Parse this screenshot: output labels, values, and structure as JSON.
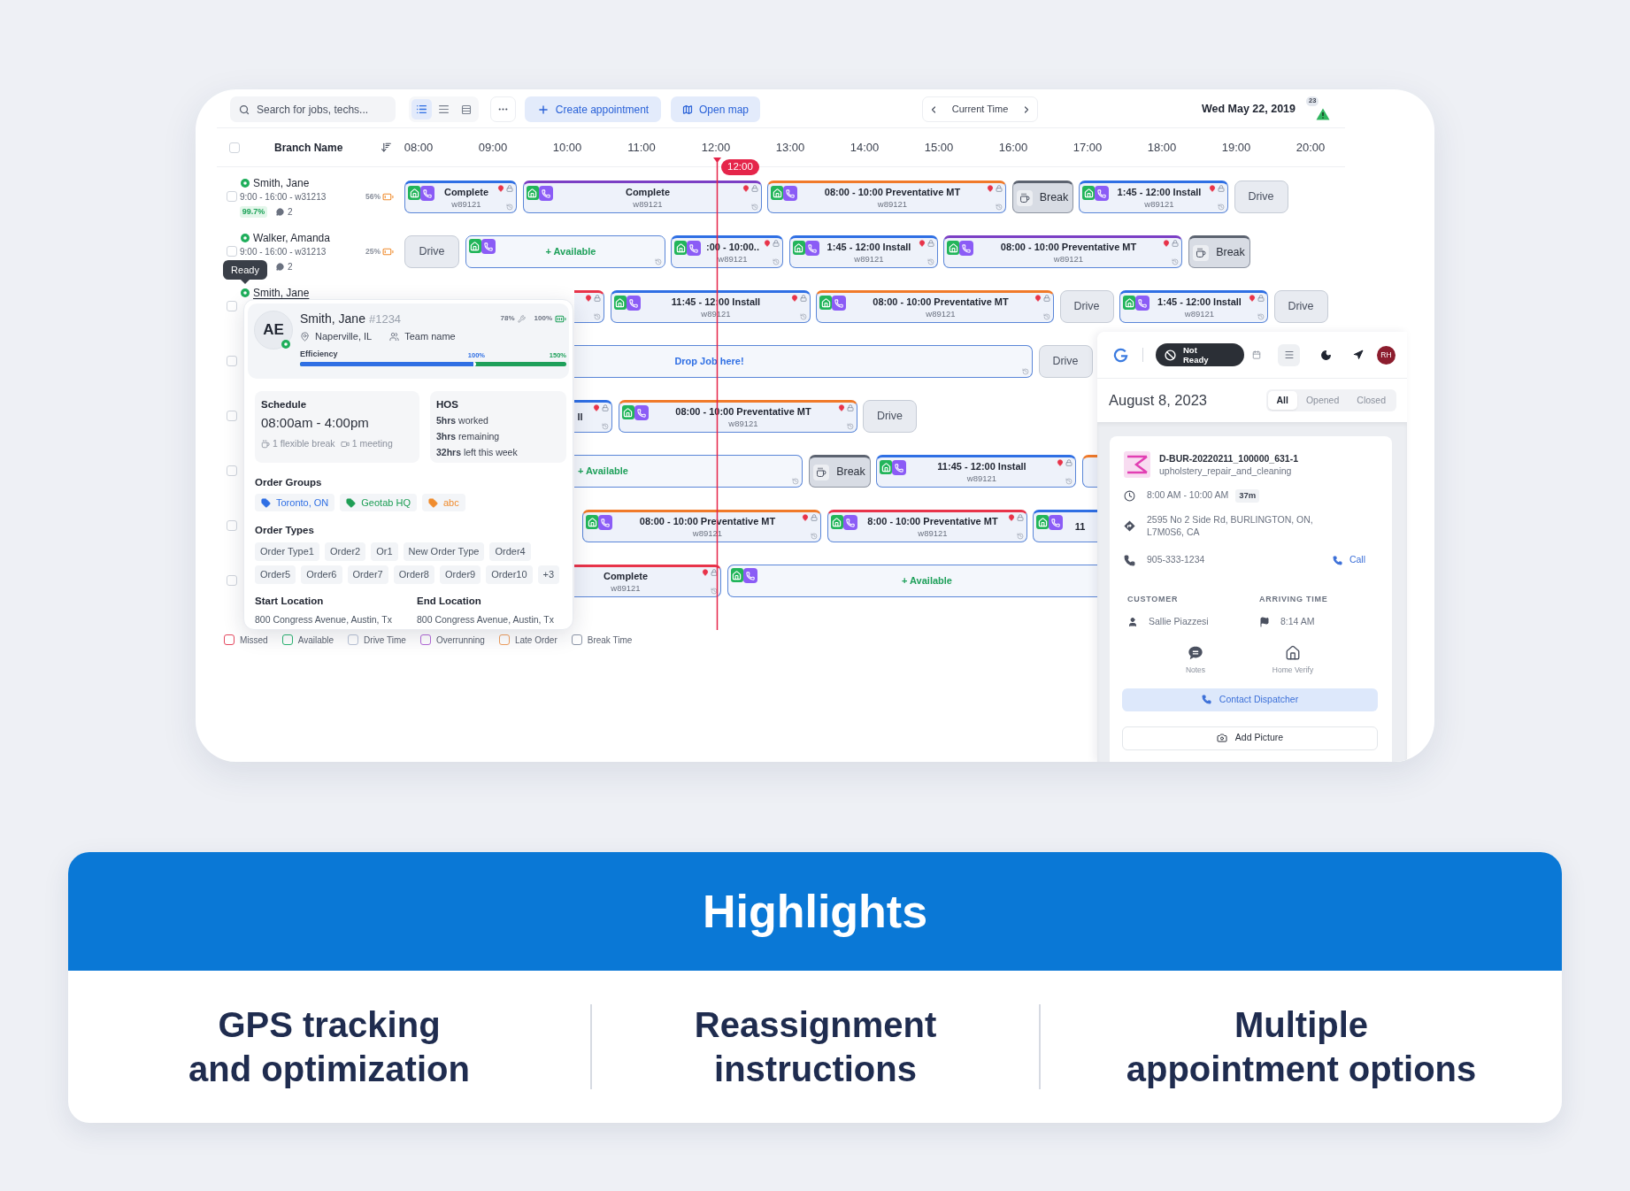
{
  "toolbar": {
    "search": {
      "placeholder": "Search for jobs, techs..."
    },
    "view_modes": [
      {
        "kind": "list",
        "selected": true
      },
      {
        "kind": "lines",
        "selected": false
      },
      {
        "kind": "compact",
        "selected": false
      }
    ],
    "create_button": "Create appointment",
    "map_button": "Open map",
    "time_nav": "Current Time",
    "date": "Wed May 22, 2019",
    "alert_count": "23"
  },
  "schedule": {
    "select_all": {
      "checked": false
    },
    "branch_label": "Branch Name",
    "hours": [
      "08:00",
      "09:00",
      "10:00",
      "11:00",
      "12:00",
      "13:00",
      "14:00",
      "15:00",
      "16:00",
      "17:00",
      "18:00",
      "19:00",
      "20:00"
    ],
    "now_marker": "12:00",
    "rows": [
      {
        "checked": false,
        "technician": {
          "name": "Smith, Jane",
          "hovered": false,
          "shift": "9:00 - 16:00 - w31213",
          "battery": "56%",
          "efficiency": "99.7%",
          "messages": "2"
        },
        "events": [
          {
            "kind": "job",
            "title": "Complete",
            "code": "w89121",
            "color": "#2f6fe4",
            "app_icons": true,
            "markers": true
          },
          {
            "kind": "job",
            "title": "Complete",
            "code": "w89121",
            "color": "#7b3fc4",
            "app_icons": true,
            "markers": true
          },
          {
            "kind": "job",
            "title": "08:00 - 10:00 Preventative MT",
            "code": "w89121",
            "color": "#f07a2a",
            "app_icons": true,
            "markers": true
          },
          {
            "kind": "break",
            "title": "Break"
          },
          {
            "kind": "job",
            "title": "1:45 - 12:00 Install",
            "code": "w89121",
            "color": "#2f6fe4",
            "app_icons": true,
            "markers": true
          },
          {
            "kind": "drive",
            "title": "Drive"
          }
        ]
      },
      {
        "checked": false,
        "technician": {
          "name": "Walker, Amanda",
          "hovered": false,
          "shift": "9:00 - 16:00 - w31213",
          "battery": "25%",
          "messages": "2"
        },
        "events": [
          {
            "kind": "drive",
            "title": "Drive"
          },
          {
            "kind": "available",
            "title": "+ Available",
            "app_icons": true,
            "markers": true
          },
          {
            "kind": "job",
            "title": ":00 - 10:00..",
            "code": "w89121",
            "color": "#2f6fe4",
            "app_icons": true,
            "markers": true
          },
          {
            "kind": "job",
            "title": "1:45 - 12:00 Install",
            "code": "w89121",
            "color": "#2f6fe4",
            "app_icons": true,
            "markers": true
          },
          {
            "kind": "job",
            "title": "08:00 - 10:00 Preventative MT",
            "code": "w89121",
            "color": "#7b3fc4",
            "app_icons": true,
            "markers": true
          },
          {
            "kind": "break",
            "title": "Break"
          }
        ]
      },
      {
        "checked": false,
        "technician": {
          "name": "Smith, Jane",
          "hovered": true,
          "tooltip": "Ready"
        },
        "events": [
          {
            "kind": "job",
            "color": "#e8344a",
            "app_icons": false,
            "markers": true
          },
          {
            "kind": "job",
            "title": "11:45 - 12:00 Install",
            "code": "w89121",
            "color": "#2f6fe4",
            "app_icons": true,
            "markers": true
          },
          {
            "kind": "job",
            "title": "08:00 - 10:00 Preventative MT",
            "code": "w89121",
            "color": "#f07a2a",
            "app_icons": true,
            "markers": true
          },
          {
            "kind": "drive",
            "title": "Drive"
          },
          {
            "kind": "job",
            "title": "1:45 - 12:00 Install",
            "code": "w89121",
            "color": "#2f6fe4",
            "app_icons": true,
            "markers": true
          },
          {
            "kind": "drive",
            "title": "Drive"
          }
        ]
      },
      {
        "checked": false,
        "events": [
          {
            "kind": "drop",
            "title": "Drop Job here!",
            "markers": true
          },
          {
            "kind": "drive",
            "title": "Drive"
          }
        ]
      },
      {
        "checked": false,
        "events": [
          {
            "kind": "job",
            "title": "ll",
            "color": "#2f6fe4",
            "app_icons": false,
            "markers": true
          },
          {
            "kind": "job",
            "title": "08:00 - 10:00 Preventative MT",
            "code": "w89121",
            "color": "#f07a2a",
            "app_icons": true,
            "markers": true
          },
          {
            "kind": "drive",
            "title": "Drive"
          }
        ]
      },
      {
        "checked": false,
        "events": [
          {
            "kind": "available",
            "title": "+ Available",
            "app_icons": false,
            "markers": true
          },
          {
            "kind": "break",
            "title": "Break"
          },
          {
            "kind": "job",
            "title": "11:45 - 12:00 Install",
            "code": "w89121",
            "color": "#2f6fe4",
            "app_icons": true,
            "markers": true
          },
          {
            "kind": "job",
            "color": "#f07a2a",
            "app_icons": false,
            "markers": false
          }
        ]
      },
      {
        "checked": false,
        "events": [
          {
            "kind": "job",
            "title": "08:00 - 10:00 Preventative MT",
            "code": "w89121",
            "color": "#f07a2a",
            "app_icons": true,
            "markers": true
          },
          {
            "kind": "job",
            "title": "8:00 - 10:00 Preventative MT",
            "code": "w89121",
            "color": "#e8344a",
            "app_icons": true,
            "markers": true
          },
          {
            "kind": "job",
            "title": "11",
            "color": "#2f6fe4",
            "app_icons": true,
            "markers": false
          }
        ]
      },
      {
        "checked": false,
        "events": [
          {
            "kind": "job",
            "title": "Complete",
            "code": "w89121",
            "color": "#e8344a",
            "app_icons": false,
            "markers": true
          },
          {
            "kind": "available",
            "title": "+ Available",
            "app_icons": true,
            "markers": false
          }
        ]
      }
    ],
    "legend": [
      {
        "label": "Missed",
        "color": "#e5485f"
      },
      {
        "label": "Available",
        "color": "#2bb673"
      },
      {
        "label": "Drive Time",
        "color": "#b9c3d6"
      },
      {
        "label": "Overrunning",
        "color": "#b36ad8"
      },
      {
        "label": "Late Order",
        "color": "#f0a060"
      },
      {
        "label": "Break Time",
        "color": "#8d97a8"
      }
    ]
  },
  "technician_card": {
    "initials": "AE",
    "name": "Smith, Jane",
    "number": "#1234",
    "signal": "78%",
    "battery": "100%",
    "location": "Naperville, IL",
    "team": "Team name",
    "efficiency_label": "Efficiency",
    "efficiency_marks": [
      "100%",
      "150%"
    ],
    "efficiency": {
      "level": 0.66
    },
    "schedule_label": "Schedule",
    "hours": "08:00am - 4:00pm",
    "breaks": "1 flexible break",
    "meetings": "1 meeting",
    "hos_label": "HOS",
    "hos": [
      "**5hrs** worked",
      "**3hrs** remaining",
      "**32hrs** left this week"
    ],
    "groups_label": "Order Groups",
    "groups": [
      {
        "label": "Toronto, ON",
        "color": "#2f6fe4"
      },
      {
        "label": "Geotab HQ",
        "color": "#1e9e55"
      },
      {
        "label": "abc",
        "color": "#f08c2e"
      }
    ],
    "types_label": "Order Types",
    "types": [
      "Order Type1",
      "Order2",
      "Or1",
      "New Order Type",
      "Order4",
      "Order5",
      "Order6",
      "Order7",
      "Order8",
      "Order9",
      "Order10",
      "+3"
    ],
    "start_label": "Start Location",
    "start": "800 Congress Avenue, Austin, Tx",
    "end_label": "End Location",
    "end": "800 Congress Avenue, Austin, Tx"
  },
  "mobile_panel": {
    "status": "Not Ready",
    "avatar": "RH",
    "date": "August 8, 2023",
    "filters": [
      {
        "label": "All",
        "selected": true
      },
      {
        "label": "Opened",
        "selected": false
      },
      {
        "label": "Closed",
        "selected": false
      }
    ],
    "job": {
      "id": "D-BUR-20220211_100000_631-1",
      "type": "upholstery_repair_and_cleaning",
      "time": "8:00 AM - 10:00 AM",
      "duration": "37m",
      "address": "2595 No 2 Side Rd, BURLINGTON, ON, L7M0S6, CA",
      "phone": "905-333-1234",
      "call_button": "Call",
      "customer_label": "CUSTOMER",
      "customer": "Sallie Piazzesi",
      "arriving_label": "ARRIVING TIME",
      "arriving": "8:14 AM",
      "actions": [
        {
          "kind": "notes",
          "label": "Notes"
        },
        {
          "kind": "home",
          "label": "Home Verify"
        }
      ],
      "contact_button": "Contact Dispatcher",
      "picture_button": "Add Picture"
    }
  },
  "highlights": {
    "title": "Highlights",
    "items": [
      "GPS tracking\nand optimization",
      "Reassignment\ninstructions",
      "Multiple\nappointment options"
    ]
  }
}
